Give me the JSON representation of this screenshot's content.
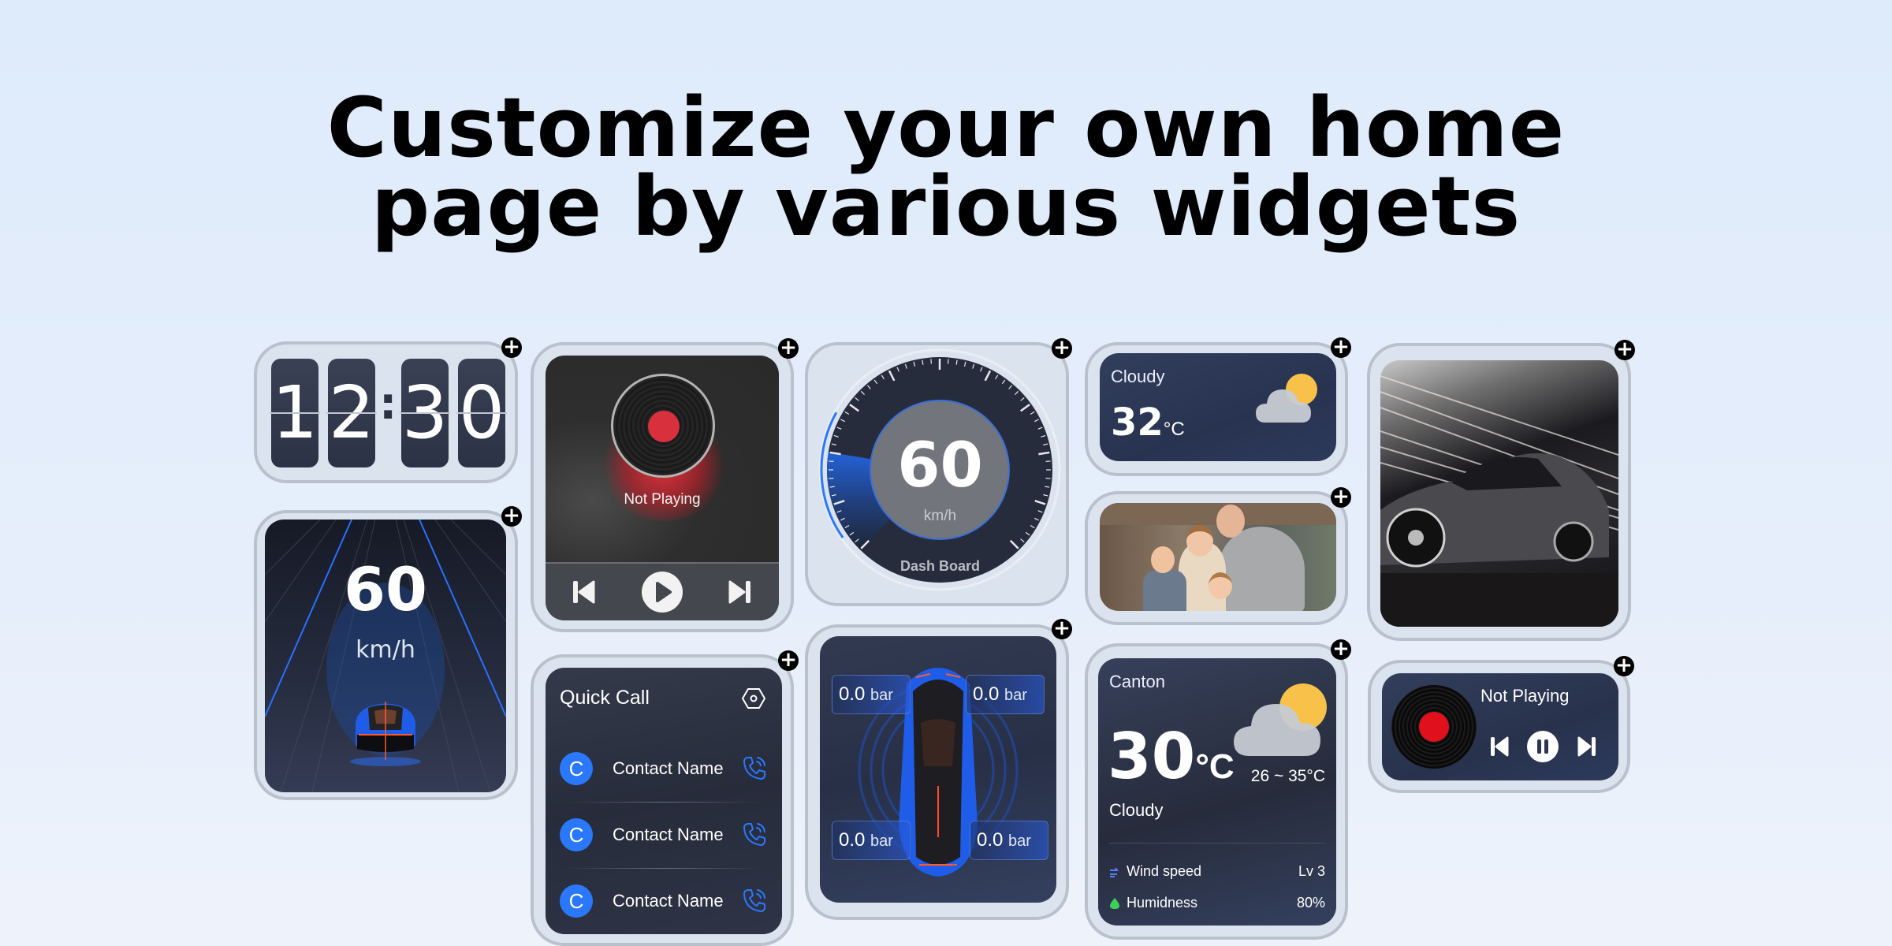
{
  "headline": {
    "line1": "Customize your own home",
    "line2": "page by various widgets"
  },
  "add_icon": "+",
  "clock": {
    "digits": [
      "1",
      "2",
      "3",
      "0"
    ],
    "separator": ":",
    "time": "12:30"
  },
  "speed_card": {
    "value": "60",
    "unit": "km/h"
  },
  "music_player": {
    "status": "Not Playing",
    "controls": [
      "previous",
      "play",
      "next"
    ]
  },
  "quick_call": {
    "title": "Quick Call",
    "settings_icon": "hexagon-settings-icon",
    "contacts": [
      {
        "initial": "C",
        "name": "Contact Name"
      },
      {
        "initial": "C",
        "name": "Contact Name"
      },
      {
        "initial": "C",
        "name": "Contact Name"
      }
    ]
  },
  "dashboard": {
    "value": "60",
    "unit": "km/h",
    "label": "Dash Board",
    "fill_fraction": 0.2
  },
  "tire_pressure": {
    "front_left": {
      "value": "0.0",
      "unit": "bar"
    },
    "front_right": {
      "value": "0.0",
      "unit": "bar"
    },
    "rear_left": {
      "value": "0.0",
      "unit": "bar"
    },
    "rear_right": {
      "value": "0.0",
      "unit": "bar"
    }
  },
  "weather_small": {
    "condition": "Cloudy",
    "temperature": "32",
    "unit": "°C"
  },
  "photo_widget": {
    "subject": "family-photo"
  },
  "weather_large": {
    "city": "Canton",
    "temperature": "30",
    "unit": "°C",
    "range": "26 ~ 35°C",
    "condition": "Cloudy",
    "details": [
      {
        "icon": "wind-icon",
        "label": "Wind speed",
        "value": "Lv 3",
        "color": "#5a7cff"
      },
      {
        "icon": "humidity-icon",
        "label": "Humidness",
        "value": "80%",
        "color": "#3ccf5a"
      }
    ]
  },
  "car_photo": {
    "subject": "sports-car-photo"
  },
  "mini_music": {
    "status": "Not Playing",
    "controls": [
      "previous",
      "pause",
      "next"
    ]
  },
  "colors": {
    "accent_blue": "#2a78ff",
    "record_red": "#d8202c",
    "card_dark": "#2a3147",
    "sun_yellow": "#f8c24a"
  }
}
